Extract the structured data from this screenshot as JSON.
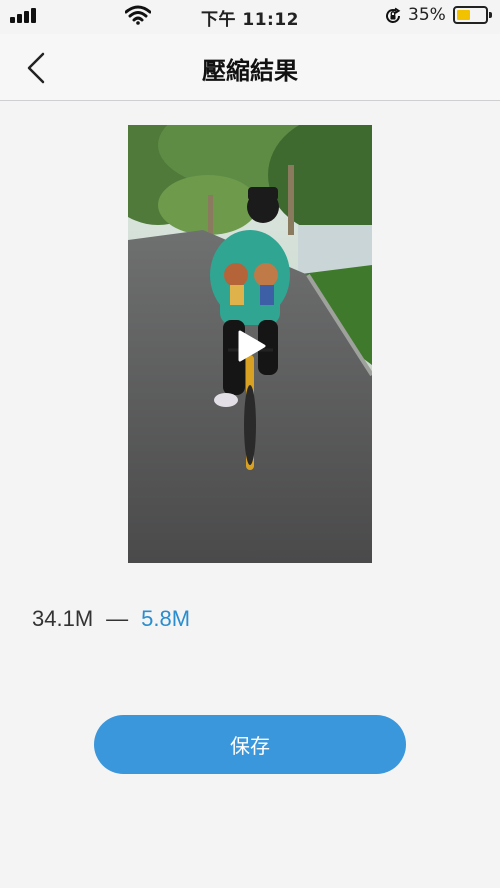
{
  "status_bar": {
    "time": "下午 11:12",
    "battery_percent": "35%",
    "battery_level": 0.35,
    "icons": [
      "signal-icon",
      "wifi-icon",
      "orientation-lock-icon",
      "battery-icon"
    ]
  },
  "nav": {
    "title": "壓縮結果",
    "back_icon": "chevron-left-icon"
  },
  "video": {
    "play_icon": "play-icon"
  },
  "sizes": {
    "original": "34.1M",
    "separator": "—",
    "compressed": "5.8M"
  },
  "actions": {
    "save_label": "保存"
  },
  "colors": {
    "accent": "#3b97db",
    "compressed_text": "#2a8dcf",
    "background": "#f4f4f5"
  }
}
